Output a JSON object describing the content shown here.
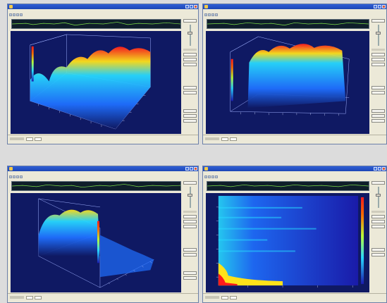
{
  "screens": [
    {
      "id": "top-left",
      "view": "3d-waterfall-a"
    },
    {
      "id": "top-right",
      "view": "3d-waterfall-b"
    },
    {
      "id": "bottom-left",
      "view": "3d-waterfall-c"
    },
    {
      "id": "bottom-right",
      "view": "spectrogram-2d"
    }
  ],
  "colors": {
    "plot_background": "#0f1963",
    "waveform_trace": "#7fe34a",
    "titlebar": "#1d46b5",
    "colormap": [
      "#1b1bb0",
      "#1f6fff",
      "#27d9ff",
      "#b8ff3a",
      "#ffe21a",
      "#ff6a00",
      "#ff1c1c"
    ]
  },
  "icons": {
    "app": "app-icon",
    "minimize": "minimize-icon",
    "maximize": "maximize-icon",
    "close": "close-icon"
  }
}
